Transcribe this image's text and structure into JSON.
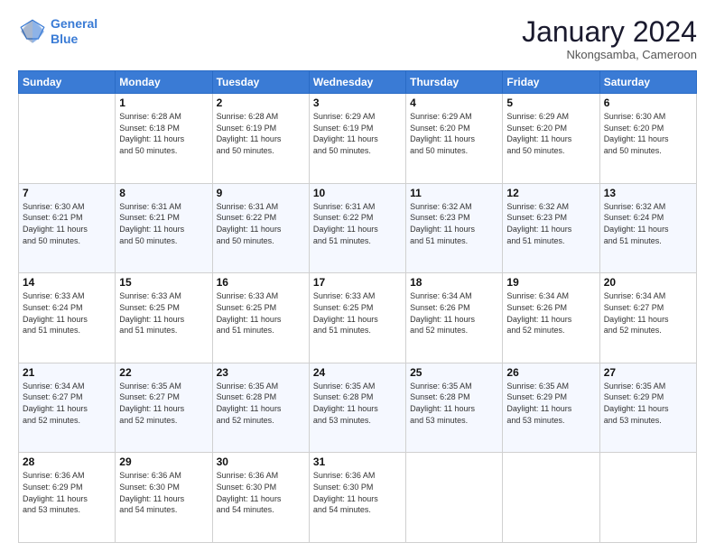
{
  "logo": {
    "line1": "General",
    "line2": "Blue"
  },
  "title": "January 2024",
  "location": "Nkongsamba, Cameroon",
  "days_of_week": [
    "Sunday",
    "Monday",
    "Tuesday",
    "Wednesday",
    "Thursday",
    "Friday",
    "Saturday"
  ],
  "weeks": [
    [
      {
        "day": "",
        "info": ""
      },
      {
        "day": "1",
        "info": "Sunrise: 6:28 AM\nSunset: 6:18 PM\nDaylight: 11 hours\nand 50 minutes."
      },
      {
        "day": "2",
        "info": "Sunrise: 6:28 AM\nSunset: 6:19 PM\nDaylight: 11 hours\nand 50 minutes."
      },
      {
        "day": "3",
        "info": "Sunrise: 6:29 AM\nSunset: 6:19 PM\nDaylight: 11 hours\nand 50 minutes."
      },
      {
        "day": "4",
        "info": "Sunrise: 6:29 AM\nSunset: 6:20 PM\nDaylight: 11 hours\nand 50 minutes."
      },
      {
        "day": "5",
        "info": "Sunrise: 6:29 AM\nSunset: 6:20 PM\nDaylight: 11 hours\nand 50 minutes."
      },
      {
        "day": "6",
        "info": "Sunrise: 6:30 AM\nSunset: 6:20 PM\nDaylight: 11 hours\nand 50 minutes."
      }
    ],
    [
      {
        "day": "7",
        "info": "Sunrise: 6:30 AM\nSunset: 6:21 PM\nDaylight: 11 hours\nand 50 minutes."
      },
      {
        "day": "8",
        "info": "Sunrise: 6:31 AM\nSunset: 6:21 PM\nDaylight: 11 hours\nand 50 minutes."
      },
      {
        "day": "9",
        "info": "Sunrise: 6:31 AM\nSunset: 6:22 PM\nDaylight: 11 hours\nand 50 minutes."
      },
      {
        "day": "10",
        "info": "Sunrise: 6:31 AM\nSunset: 6:22 PM\nDaylight: 11 hours\nand 51 minutes."
      },
      {
        "day": "11",
        "info": "Sunrise: 6:32 AM\nSunset: 6:23 PM\nDaylight: 11 hours\nand 51 minutes."
      },
      {
        "day": "12",
        "info": "Sunrise: 6:32 AM\nSunset: 6:23 PM\nDaylight: 11 hours\nand 51 minutes."
      },
      {
        "day": "13",
        "info": "Sunrise: 6:32 AM\nSunset: 6:24 PM\nDaylight: 11 hours\nand 51 minutes."
      }
    ],
    [
      {
        "day": "14",
        "info": "Sunrise: 6:33 AM\nSunset: 6:24 PM\nDaylight: 11 hours\nand 51 minutes."
      },
      {
        "day": "15",
        "info": "Sunrise: 6:33 AM\nSunset: 6:25 PM\nDaylight: 11 hours\nand 51 minutes."
      },
      {
        "day": "16",
        "info": "Sunrise: 6:33 AM\nSunset: 6:25 PM\nDaylight: 11 hours\nand 51 minutes."
      },
      {
        "day": "17",
        "info": "Sunrise: 6:33 AM\nSunset: 6:25 PM\nDaylight: 11 hours\nand 51 minutes."
      },
      {
        "day": "18",
        "info": "Sunrise: 6:34 AM\nSunset: 6:26 PM\nDaylight: 11 hours\nand 52 minutes."
      },
      {
        "day": "19",
        "info": "Sunrise: 6:34 AM\nSunset: 6:26 PM\nDaylight: 11 hours\nand 52 minutes."
      },
      {
        "day": "20",
        "info": "Sunrise: 6:34 AM\nSunset: 6:27 PM\nDaylight: 11 hours\nand 52 minutes."
      }
    ],
    [
      {
        "day": "21",
        "info": "Sunrise: 6:34 AM\nSunset: 6:27 PM\nDaylight: 11 hours\nand 52 minutes."
      },
      {
        "day": "22",
        "info": "Sunrise: 6:35 AM\nSunset: 6:27 PM\nDaylight: 11 hours\nand 52 minutes."
      },
      {
        "day": "23",
        "info": "Sunrise: 6:35 AM\nSunset: 6:28 PM\nDaylight: 11 hours\nand 52 minutes."
      },
      {
        "day": "24",
        "info": "Sunrise: 6:35 AM\nSunset: 6:28 PM\nDaylight: 11 hours\nand 53 minutes."
      },
      {
        "day": "25",
        "info": "Sunrise: 6:35 AM\nSunset: 6:28 PM\nDaylight: 11 hours\nand 53 minutes."
      },
      {
        "day": "26",
        "info": "Sunrise: 6:35 AM\nSunset: 6:29 PM\nDaylight: 11 hours\nand 53 minutes."
      },
      {
        "day": "27",
        "info": "Sunrise: 6:35 AM\nSunset: 6:29 PM\nDaylight: 11 hours\nand 53 minutes."
      }
    ],
    [
      {
        "day": "28",
        "info": "Sunrise: 6:36 AM\nSunset: 6:29 PM\nDaylight: 11 hours\nand 53 minutes."
      },
      {
        "day": "29",
        "info": "Sunrise: 6:36 AM\nSunset: 6:30 PM\nDaylight: 11 hours\nand 54 minutes."
      },
      {
        "day": "30",
        "info": "Sunrise: 6:36 AM\nSunset: 6:30 PM\nDaylight: 11 hours\nand 54 minutes."
      },
      {
        "day": "31",
        "info": "Sunrise: 6:36 AM\nSunset: 6:30 PM\nDaylight: 11 hours\nand 54 minutes."
      },
      {
        "day": "",
        "info": ""
      },
      {
        "day": "",
        "info": ""
      },
      {
        "day": "",
        "info": ""
      }
    ]
  ]
}
